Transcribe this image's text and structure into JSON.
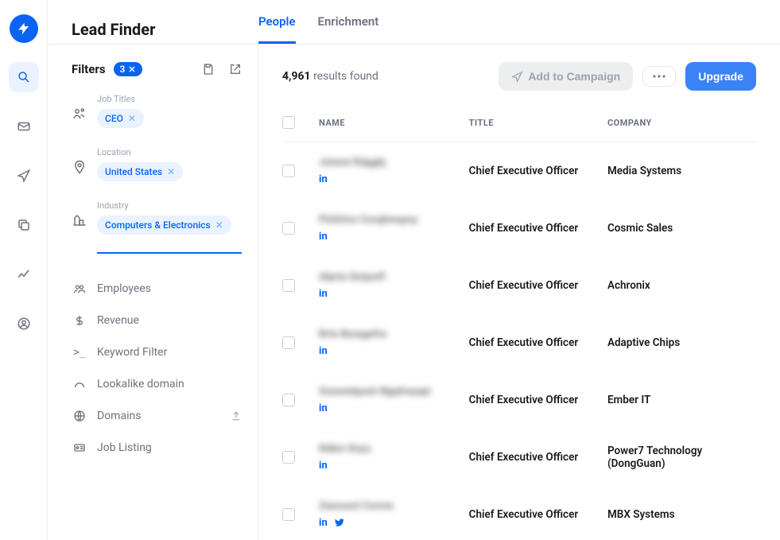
{
  "page_title": "Lead Finder",
  "tabs": [
    {
      "label": "People",
      "active": true
    },
    {
      "label": "Enrichment",
      "active": false
    }
  ],
  "filters": {
    "heading": "Filters",
    "count": "3",
    "applied": [
      {
        "label": "Job Titles",
        "value": "CEO"
      },
      {
        "label": "Location",
        "value": "United States"
      },
      {
        "label": "Industry",
        "value": "Computers & Electronics",
        "underline": true
      }
    ],
    "available": [
      {
        "label": "Employees",
        "icon": "people"
      },
      {
        "label": "Revenue",
        "icon": "dollar"
      },
      {
        "label": "Keyword Filter",
        "icon": "prompt"
      },
      {
        "label": "Lookalike domain",
        "icon": "arc"
      },
      {
        "label": "Domains",
        "icon": "globe",
        "trail": "upload"
      },
      {
        "label": "Job Listing",
        "icon": "card"
      }
    ]
  },
  "results": {
    "count": "4,961",
    "suffix": "results found"
  },
  "actions": {
    "add_campaign": "Add to Campaign",
    "upgrade": "Upgrade"
  },
  "table": {
    "headers": {
      "name": "NAME",
      "title": "TITLE",
      "company": "COMPANY"
    },
    "rows": [
      {
        "name_cipher": "Jolomi Rdggkj",
        "title": "Chief Executive Officer",
        "company": "Media Systems",
        "socials": [
          "in"
        ]
      },
      {
        "name_cipher": "Plcktmo Cosqheopoy",
        "title": "Chief Executive Officer",
        "company": "Cosmic Sales",
        "socials": [
          "in"
        ]
      },
      {
        "name_cipher": "Alpria Qmjusfl",
        "title": "Chief Executive Officer",
        "company": "Achronix",
        "socials": [
          "in"
        ]
      },
      {
        "name_cipher": "Brts Buragefre",
        "title": "Chief Executive Officer",
        "company": "Adaptive Chips",
        "socials": [
          "in"
        ]
      },
      {
        "name_cipher": "Ousoedqush Ngqfreyapi",
        "title": "Chief Executive Officer",
        "company": "Ember IT",
        "socials": [
          "in"
        ]
      },
      {
        "name_cipher": "Kdlen Xnyu",
        "title": "Chief Executive Officer",
        "company": "Power7 Technology (DongGuan)",
        "socials": [
          "in"
        ]
      },
      {
        "name_cipher": "Zeeouorl Corme",
        "title": "Chief Executive Officer",
        "company": "MBX Systems",
        "socials": [
          "in",
          "tw"
        ]
      }
    ]
  },
  "colors": {
    "accent": "#0b63f6",
    "primary_btn": "#3b82f6",
    "muted": "#6b7280"
  }
}
